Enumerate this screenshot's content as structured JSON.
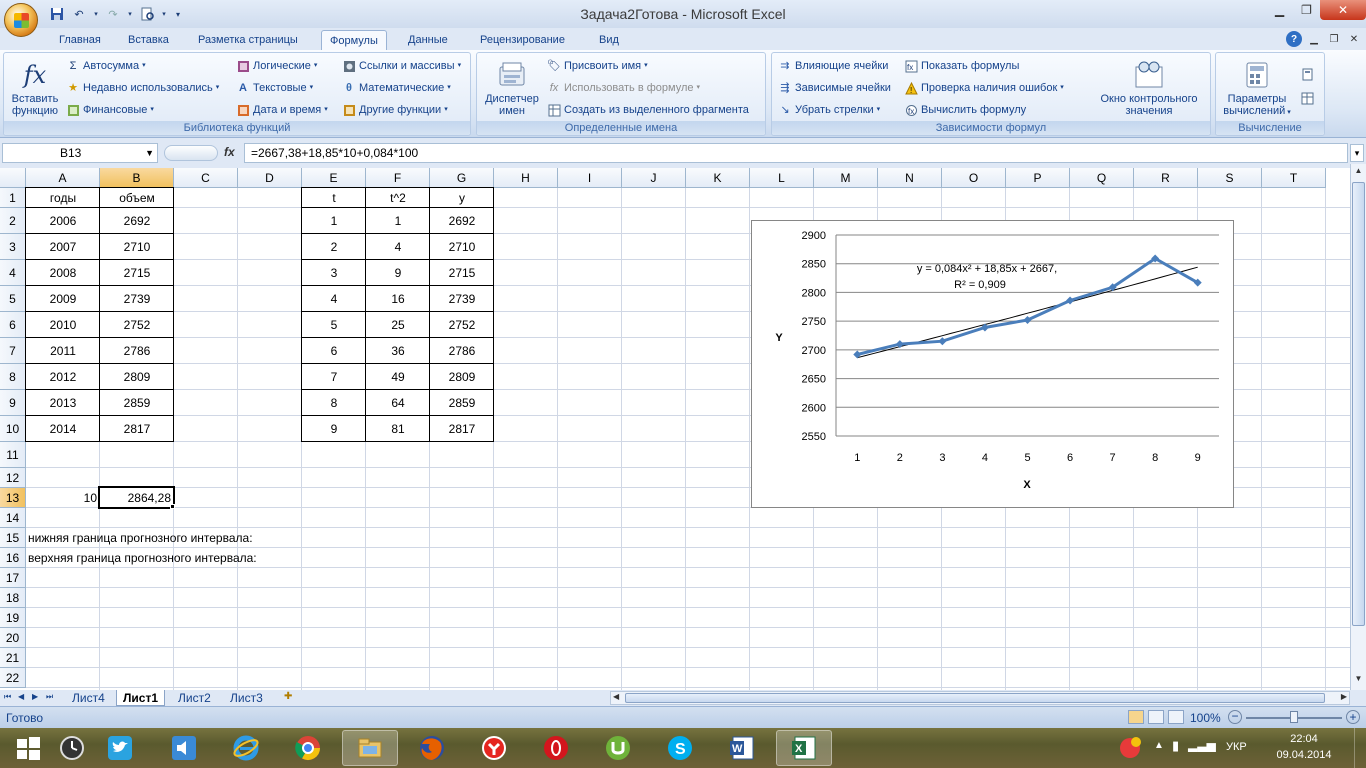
{
  "window": {
    "title": "Задача2Готова - Microsoft Excel"
  },
  "ribbon_tabs": [
    {
      "label": "Главная"
    },
    {
      "label": "Вставка"
    },
    {
      "label": "Разметка страницы"
    },
    {
      "label": "Формулы"
    },
    {
      "label": "Данные"
    },
    {
      "label": "Рецензирование"
    },
    {
      "label": "Вид"
    }
  ],
  "ribbon": {
    "library": {
      "label": "Библиотека функций",
      "insert_function": "Вставить функцию",
      "autosum": "Автосумма",
      "recent": "Недавно использовались",
      "financial": "Финансовые",
      "logical": "Логические",
      "text": "Текстовые",
      "datetime": "Дата и время",
      "lookup": "Ссылки и массивы",
      "math": "Математические",
      "other": "Другие функции"
    },
    "names": {
      "label": "Определенные имена",
      "manager": "Диспетчер имен",
      "define": "Присвоить имя",
      "use_in_formula": "Использовать в формуле",
      "create_from_selection": "Создать из выделенного фрагмента"
    },
    "auditing": {
      "label": "Зависимости формул",
      "trace_precedents": "Влияющие ячейки",
      "trace_dependents": "Зависимые ячейки",
      "remove_arrows": "Убрать стрелки",
      "show_formulas": "Показать формулы",
      "error_checking": "Проверка наличия ошибок",
      "evaluate": "Вычислить формулу",
      "watch_window": "Окно контрольного значения"
    },
    "calculation": {
      "label": "Вычисление",
      "options": "Параметры вычислений"
    }
  },
  "formula_bar": {
    "name_box": "B13",
    "fx": "fx",
    "formula": "=2667,38+18,85*10+0,084*100"
  },
  "columns": [
    "A",
    "B",
    "C",
    "D",
    "E",
    "F",
    "G",
    "H",
    "I",
    "J",
    "K",
    "L",
    "M",
    "N",
    "O",
    "P",
    "Q",
    "R",
    "S",
    "T"
  ],
  "rows": [
    "1",
    "2",
    "3",
    "4",
    "5",
    "6",
    "7",
    "8",
    "9",
    "10",
    "11",
    "12",
    "13",
    "14",
    "15",
    "16",
    "17",
    "18",
    "19",
    "20",
    "21",
    "22"
  ],
  "cells": {
    "A1": "годы",
    "B1": "объем",
    "A2": "2006",
    "B2": "2692",
    "A3": "2007",
    "B3": "2710",
    "A4": "2008",
    "B4": "2715",
    "A5": "2009",
    "B5": "2739",
    "A6": "2010",
    "B6": "2752",
    "A7": "2011",
    "B7": "2786",
    "A8": "2012",
    "B8": "2809",
    "A9": "2013",
    "B9": "2859",
    "A10": "2014",
    "B10": "2817",
    "E1": "t",
    "F1": "t^2",
    "G1": "y",
    "E2": "1",
    "F2": "1",
    "G2": "2692",
    "E3": "2",
    "F3": "4",
    "G3": "2710",
    "E4": "3",
    "F4": "9",
    "G4": "2715",
    "E5": "4",
    "F5": "16",
    "G5": "2739",
    "E6": "5",
    "F6": "25",
    "G6": "2752",
    "E7": "6",
    "F7": "36",
    "G7": "2786",
    "E8": "7",
    "F8": "49",
    "G8": "2809",
    "E9": "8",
    "F9": "64",
    "G9": "2859",
    "E10": "9",
    "F10": "81",
    "G10": "2817",
    "A13": "10",
    "B13": "2864,28",
    "A15": "нижняя граница прогнозного интервала:",
    "A16": "верхняя граница прогнозного интервала:"
  },
  "chart_data": {
    "type": "line",
    "x": [
      1,
      2,
      3,
      4,
      5,
      6,
      7,
      8,
      9
    ],
    "series": [
      {
        "values": [
          2692,
          2710,
          2715,
          2739,
          2752,
          2786,
          2809,
          2859,
          2817
        ],
        "color": "#4a7ebb"
      }
    ],
    "trendline": {
      "type": "polynomial",
      "color": "#000000"
    },
    "equation": "y = 0,084x² + 18,85x + 2667,",
    "r2": "R² = 0,909",
    "xlabel": "X",
    "ylabel": "Y",
    "ylim": [
      2550,
      2900
    ],
    "yticks": [
      "2550",
      "2600",
      "2650",
      "2700",
      "2750",
      "2800",
      "2850",
      "2900"
    ],
    "xticks": [
      "1",
      "2",
      "3",
      "4",
      "5",
      "6",
      "7",
      "8",
      "9"
    ],
    "grid": true
  },
  "sheets": [
    {
      "label": "Лист4"
    },
    {
      "label": "Лист1"
    },
    {
      "label": "Лист2"
    },
    {
      "label": "Лист3"
    }
  ],
  "status": {
    "ready": "Готово",
    "zoom": "100%"
  },
  "tray": {
    "lang": "УКР",
    "time": "22:04",
    "date": "09.04.2014"
  }
}
